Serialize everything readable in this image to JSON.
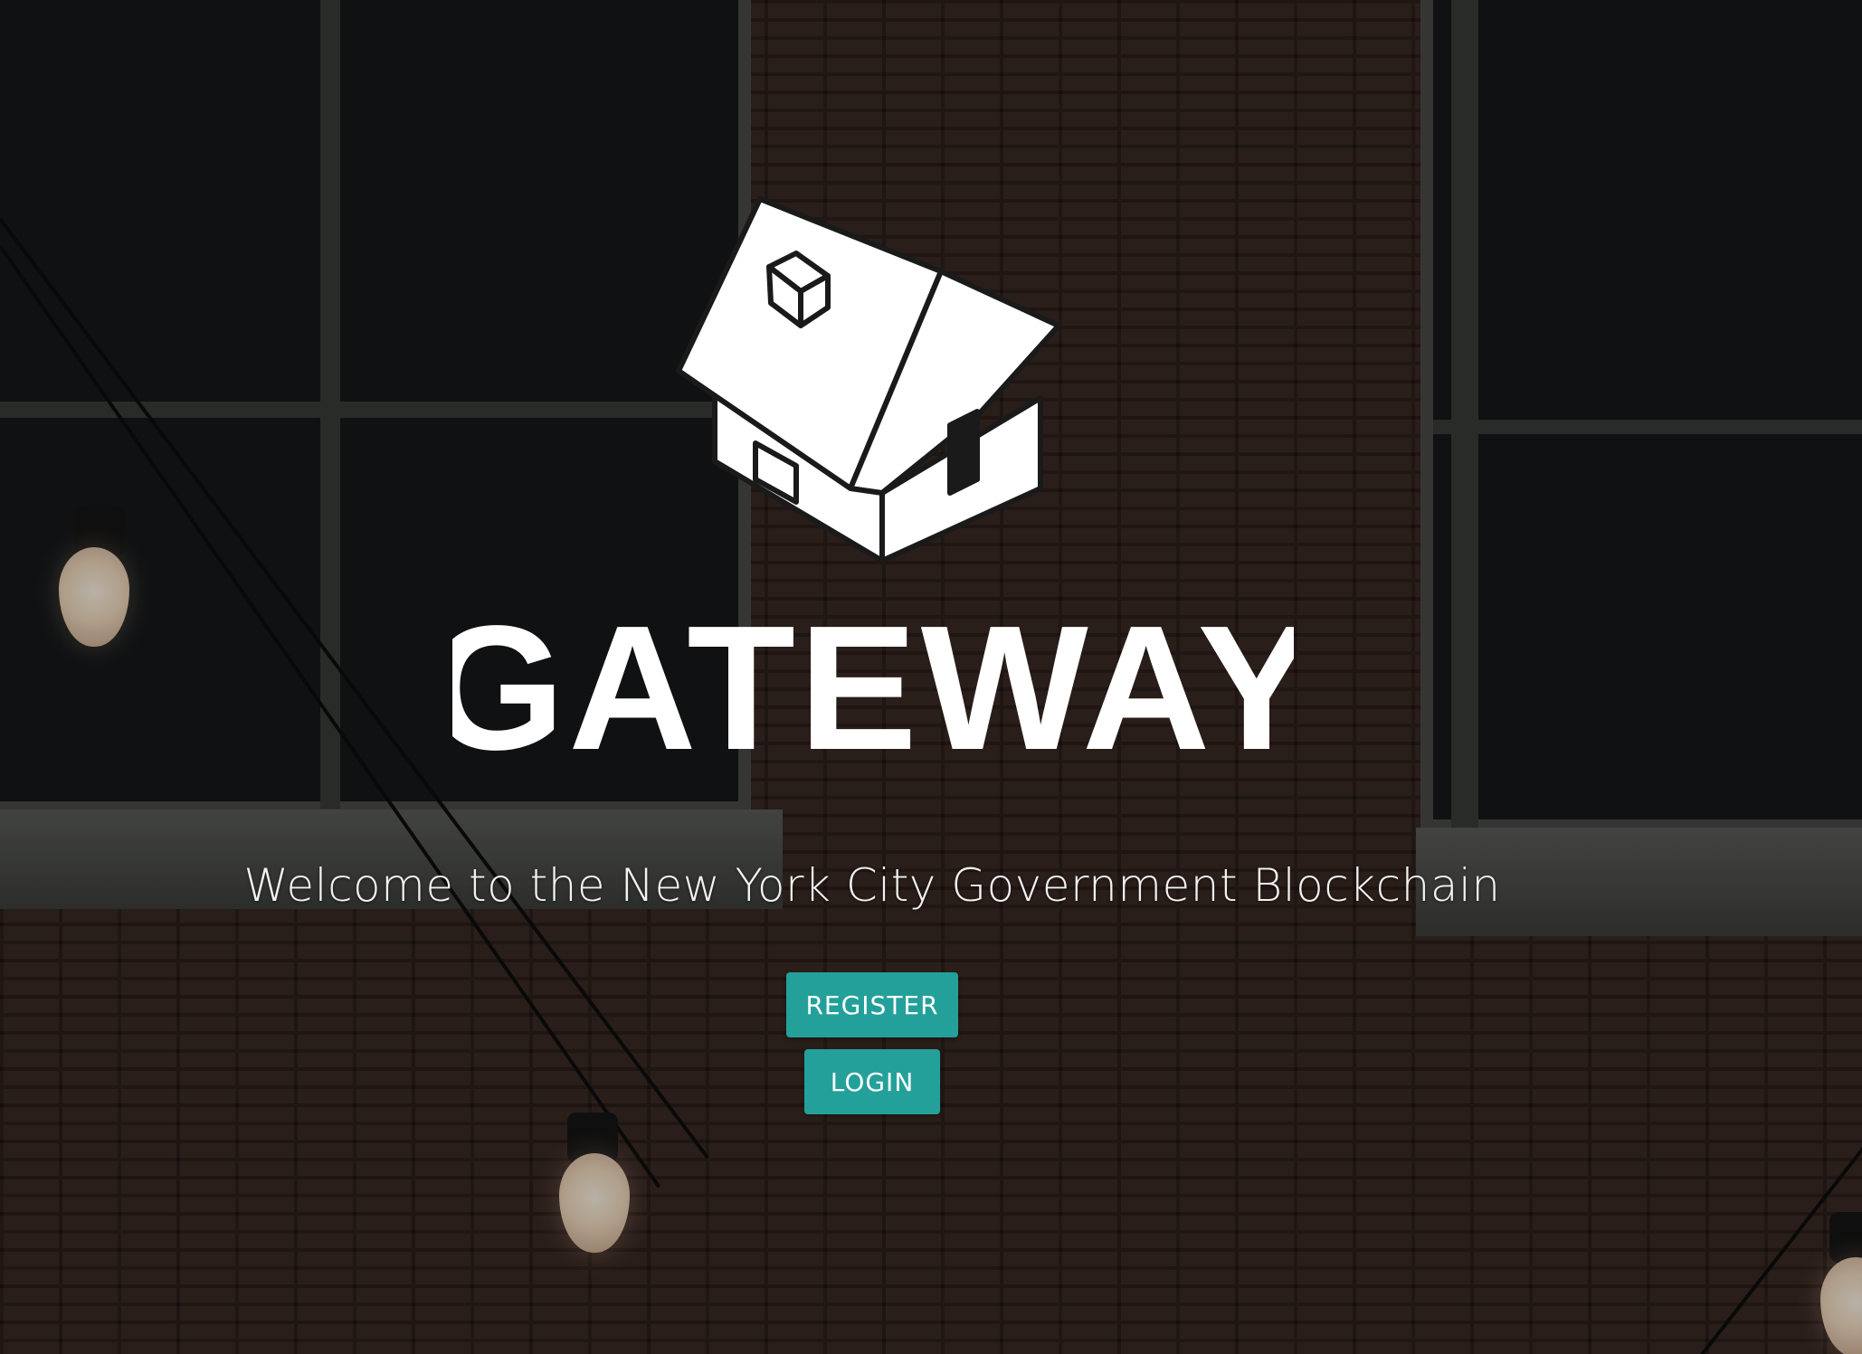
{
  "page": {
    "logo_text": "GATEWAY",
    "welcome_text": "Welcome to the New York City Government Blockchain"
  },
  "actions": {
    "register_label": "REGISTER",
    "login_label": "LOGIN"
  },
  "icons": {
    "logo": "house-icon"
  },
  "colors": {
    "button_bg": "#24a09a",
    "button_text": "#ffffff",
    "logo": "#ffffff",
    "welcome_text": "#f2f2f2"
  }
}
